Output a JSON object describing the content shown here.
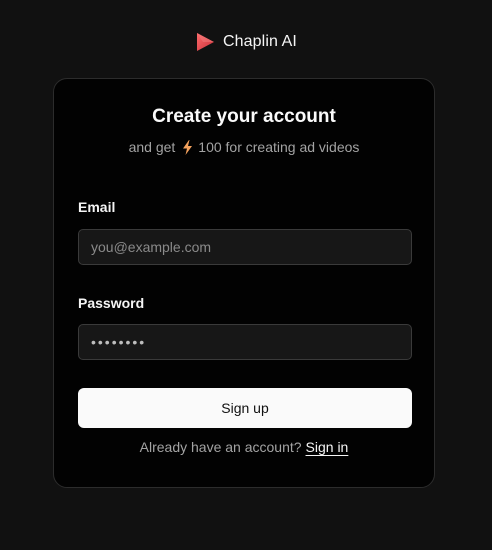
{
  "brand": {
    "name": "Chaplin AI",
    "logo_icon": "play-triangle-icon",
    "logo_color": "#e5484d"
  },
  "card": {
    "title": "Create your account",
    "subtitle_prefix": "and get",
    "subtitle_icon": "lightning-bolt-icon",
    "subtitle_icon_color": "#f5a25d",
    "subtitle_suffix": "100 for creating ad videos"
  },
  "form": {
    "email_label": "Email",
    "email_placeholder": "you@example.com",
    "email_value": "",
    "password_label": "Password",
    "password_value": "••••••••",
    "signup_label": "Sign up"
  },
  "footer": {
    "prompt": "Already have an account?",
    "signin_label": "Sign in"
  }
}
